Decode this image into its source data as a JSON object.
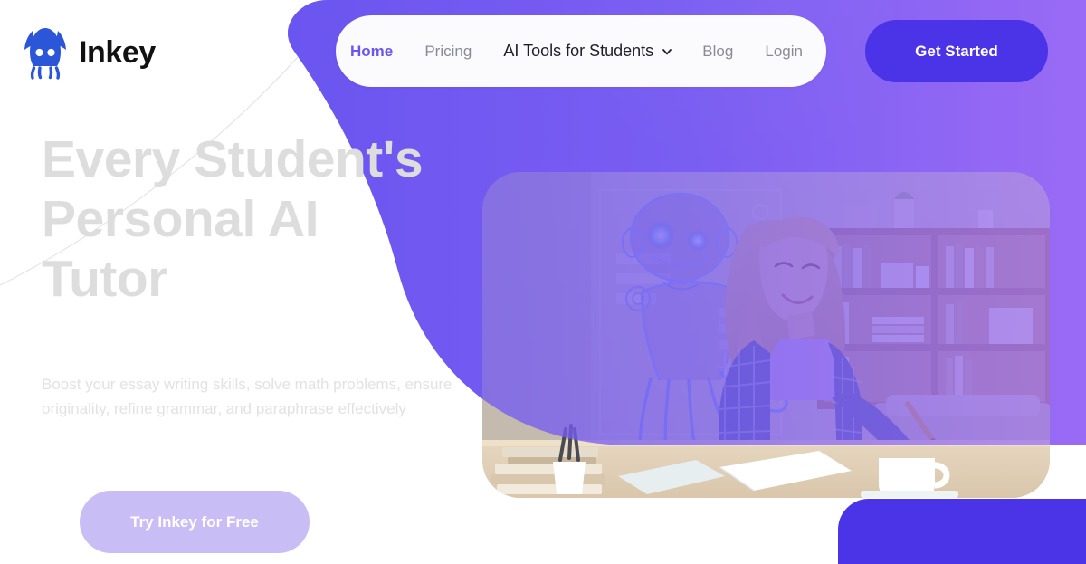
{
  "brand": {
    "name": "Inkey",
    "logo_icon": "squid-logo-icon",
    "logo_color": "#2b56d8"
  },
  "nav": {
    "items": [
      {
        "label": "Home",
        "state": "active",
        "has_dropdown": false
      },
      {
        "label": "Pricing",
        "state": "default",
        "has_dropdown": false
      },
      {
        "label": "AI Tools for Students",
        "state": "emphasis",
        "has_dropdown": true
      },
      {
        "label": "Blog",
        "state": "default",
        "has_dropdown": false
      },
      {
        "label": "Login",
        "state": "default",
        "has_dropdown": false
      }
    ],
    "dropdown_icon": "chevron-down-icon",
    "cta_label": "Get Started"
  },
  "hero": {
    "headline": "Every Student's Personal AI Tutor",
    "subcopy": "Boost your essay writing skills, solve math problems, ensure originality, refine grammar, and paraphrase effectively",
    "cta_label": "Try Inkey for Free",
    "image_alt": "Smiling student writing in a notebook at a desk beside a glowing holographic octopus AI tutor, with bookshelves behind"
  },
  "theme": {
    "purple_left": "#6b55f0",
    "purple_right": "#9a6bf5",
    "accent_button": "#4b33e8",
    "soft_button": "#c8bef5",
    "nav_pill_bg": "#fbfafc",
    "nav_active": "#6b55f0",
    "nav_muted": "#8b8b94",
    "nav_strong": "#1f1f28",
    "headline_color": "#dddddd",
    "subcopy_color": "#e2e2e4",
    "page_bg": "#ffffff"
  }
}
